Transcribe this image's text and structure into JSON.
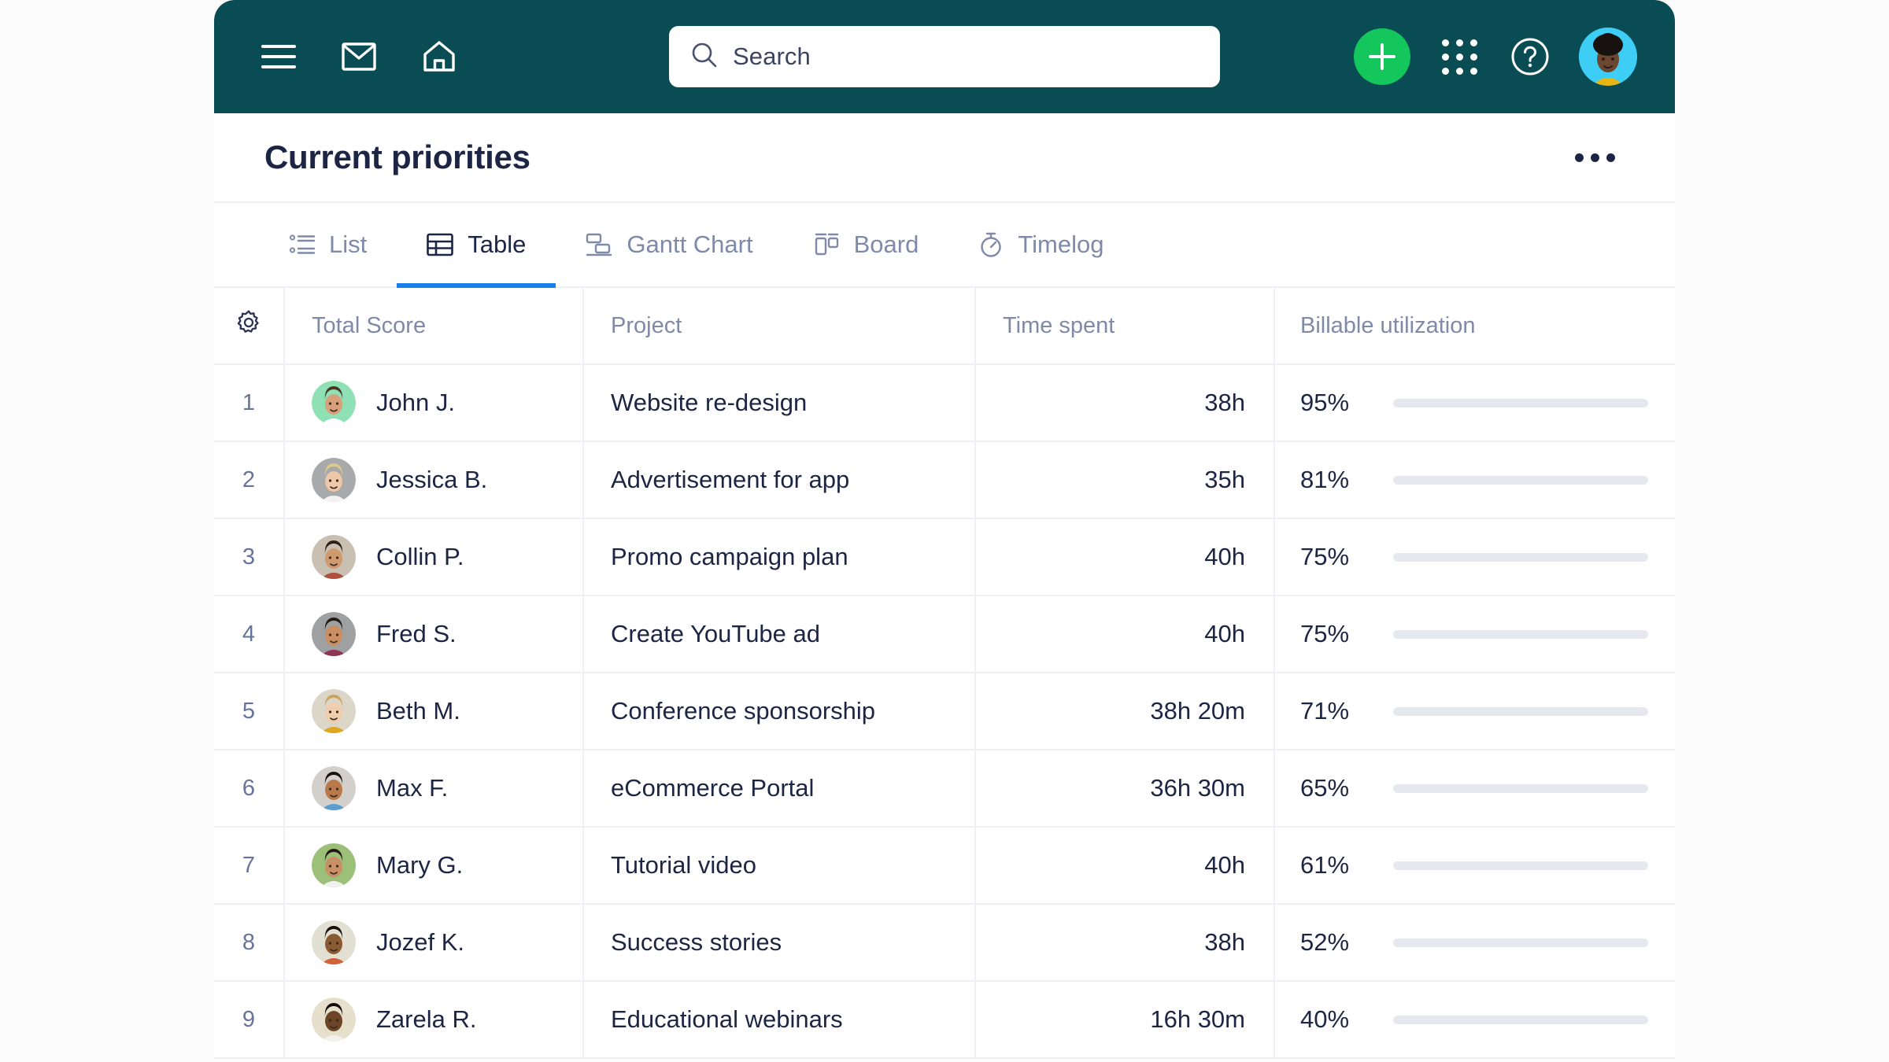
{
  "topbar": {
    "menu_icon": "hamburger-menu-icon",
    "mail_icon": "envelope-icon",
    "home_icon": "home-icon",
    "search_placeholder": "Search",
    "search_value": "",
    "search_icon": "search-icon",
    "add_label": "+",
    "apps_icon": "grid-apps-icon",
    "help_icon": "help-circle-icon",
    "avatar_icon": "user-avatar",
    "bg_color": "#0A4C54",
    "add_color": "#13C75C",
    "avatar_bg": "#3ECDF5"
  },
  "page": {
    "title": "Current priorities",
    "more_label": "More options"
  },
  "tabs": [
    {
      "label": "List",
      "icon": "list-icon",
      "active": false
    },
    {
      "label": "Table",
      "icon": "table-icon",
      "active": true
    },
    {
      "label": "Gantt Chart",
      "icon": "gantt-chart-icon",
      "active": false
    },
    {
      "label": "Board",
      "icon": "board-icon",
      "active": false
    },
    {
      "label": "Timelog",
      "icon": "stopwatch-icon",
      "active": false
    }
  ],
  "table": {
    "settings_icon": "gear-icon",
    "columns": [
      "Total Score",
      "Project",
      "Time spent",
      "Billable utilization"
    ],
    "accent_blue": "#1B7FEA",
    "bar_colors": {
      "high": "#15C65A",
      "medium": "#FCBE0A",
      "low": "#F0344C"
    },
    "bar_track": "#E6E8EF",
    "rows": [
      {
        "num": "1",
        "name": "John J.",
        "project": "Website re-design",
        "time": "38h",
        "pct": "95%",
        "pct_value": 95,
        "color": "#15C65A",
        "avatar_bg": "#8FE0B4",
        "skin": "#d8a07a",
        "hair": "#4a3525",
        "shirt": "#ffffff"
      },
      {
        "num": "2",
        "name": "Jessica B.",
        "project": "Advertisement for app",
        "time": "35h",
        "pct": "81%",
        "pct_value": 81,
        "color": "#15C65A",
        "avatar_bg": "#a8a9ab",
        "skin": "#eec6a8",
        "hair": "#e0c88a",
        "shirt": "#f2f2f2"
      },
      {
        "num": "3",
        "name": "Collin P.",
        "project": "Promo campaign plan",
        "time": "40h",
        "pct": "75%",
        "pct_value": 75,
        "color": "#15C65A",
        "avatar_bg": "#c9bfb2",
        "skin": "#cf9a6e",
        "hair": "#2c2017",
        "shirt": "#b0503c"
      },
      {
        "num": "4",
        "name": "Fred S.",
        "project": "Create YouTube ad",
        "time": "40h",
        "pct": "75%",
        "pct_value": 75,
        "color": "#15C65A",
        "avatar_bg": "#9fa0a2",
        "skin": "#c98e62",
        "hair": "#1f1a16",
        "shirt": "#8e3450"
      },
      {
        "num": "5",
        "name": "Beth M.",
        "project": "Conference sponsorship",
        "time": "38h 20m",
        "pct": "71%",
        "pct_value": 71,
        "color": "#15C65A",
        "avatar_bg": "#dcd6c8",
        "skin": "#f0cdae",
        "hair": "#c9a45e",
        "shirt": "#e0a822"
      },
      {
        "num": "6",
        "name": "Max F.",
        "project": "eCommerce Portal",
        "time": "36h 30m",
        "pct": "65%",
        "pct_value": 65,
        "color": "#FCBE0A",
        "avatar_bg": "#d3d0cb",
        "skin": "#b9794b",
        "hair": "#17120e",
        "shirt": "#5b9dd0"
      },
      {
        "num": "7",
        "name": "Mary G.",
        "project": "Tutorial video",
        "time": "40h",
        "pct": "61%",
        "pct_value": 61,
        "color": "#FCBE0A",
        "avatar_bg": "#9cbf7a",
        "skin": "#c98f64",
        "hair": "#241912",
        "shirt": "#f0f0ee"
      },
      {
        "num": "8",
        "name": "Jozef K.",
        "project": "Success stories",
        "time": "38h",
        "pct": "52%",
        "pct_value": 52,
        "color": "#FCBE0A",
        "avatar_bg": "#e2e0d2",
        "skin": "#8a5a33",
        "hair": "#140f0b",
        "shirt": "#d2603a"
      },
      {
        "num": "9",
        "name": "Zarela R.",
        "project": "Educational webinars",
        "time": "16h 30m",
        "pct": "40%",
        "pct_value": 40,
        "color": "#F0344C",
        "avatar_bg": "#e6dfcb",
        "skin": "#6d4526",
        "hair": "#120d09",
        "shirt": "#f3f1ec"
      }
    ]
  }
}
